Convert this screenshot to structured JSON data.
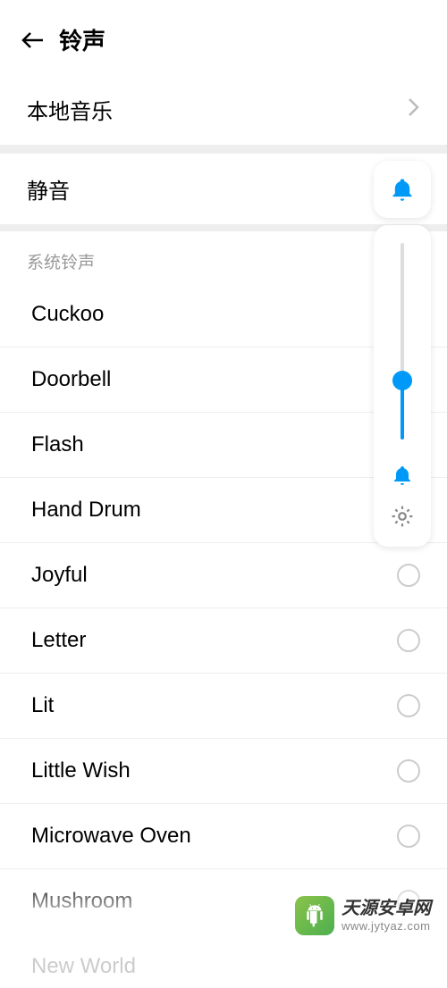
{
  "header": {
    "title": "铃声"
  },
  "localMusic": {
    "label": "本地音乐"
  },
  "silent": {
    "label": "静音"
  },
  "systemSection": {
    "title": "系统铃声"
  },
  "ringtones": [
    {
      "name": "Cuckoo"
    },
    {
      "name": "Doorbell"
    },
    {
      "name": "Flash"
    },
    {
      "name": "Hand Drum"
    },
    {
      "name": "Joyful"
    },
    {
      "name": "Letter"
    },
    {
      "name": "Lit"
    },
    {
      "name": "Little Wish"
    },
    {
      "name": "Microwave Oven"
    },
    {
      "name": "Mushroom"
    },
    {
      "name": "New World"
    }
  ],
  "volume": {
    "level_percent": 30,
    "icon_top": "bell",
    "icon_bottom": "bell"
  },
  "watermark": {
    "title": "天源安卓网",
    "subtitle": "www.jytyaz.com"
  },
  "colors": {
    "accent": "#0099f7",
    "logo_green": "#6ab82f"
  }
}
